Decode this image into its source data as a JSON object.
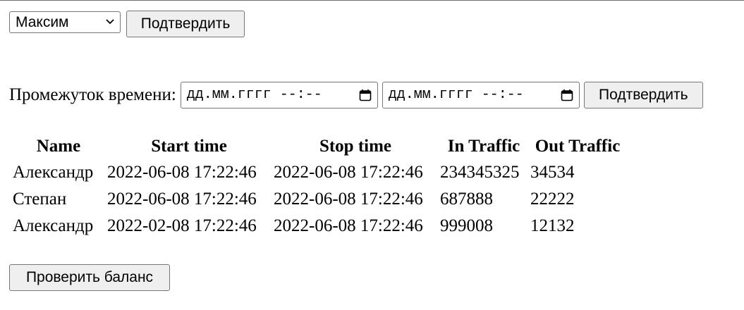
{
  "user_form": {
    "selected_user": "Максим",
    "submit_label": "Подтвердить"
  },
  "period_form": {
    "label": "Промежуток времени:",
    "start_placeholder": "дд.мм.гггг --:--",
    "end_placeholder": "дд.мм.гггг --:--",
    "submit_label": "Подтвердить"
  },
  "table": {
    "headers": [
      "Name",
      "Start time",
      "Stop time",
      "In Traffic",
      "Out Traffic"
    ],
    "rows": [
      [
        "Александр",
        "2022-06-08 17:22:46",
        "2022-06-08 17:22:46",
        "234345325",
        "34534"
      ],
      [
        "Степан",
        "2022-06-08 17:22:46",
        "2022-06-08 17:22:46",
        "687888",
        "22222"
      ],
      [
        "Александр",
        "2022-02-08 17:22:46",
        "2022-06-08 17:22:46",
        "999008",
        "12132"
      ]
    ]
  },
  "balance_button": {
    "label": "Проверить баланс"
  },
  "icons": {
    "select_arrow": "chevron-down-icon",
    "date_picker": "calendar-icon"
  }
}
